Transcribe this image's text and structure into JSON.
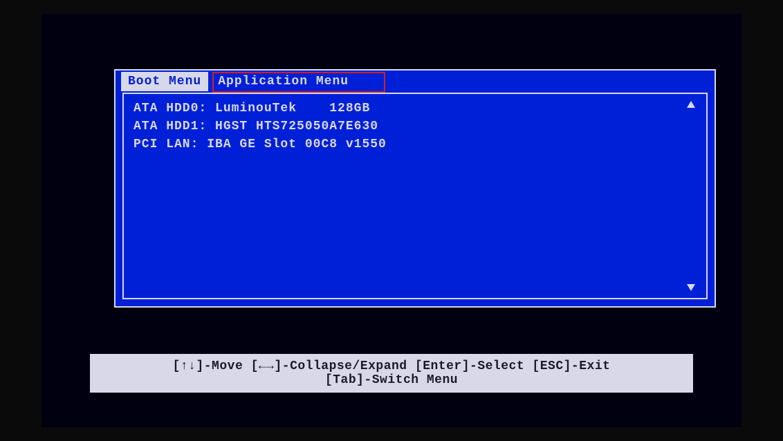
{
  "tabs": [
    {
      "label": "Boot Menu",
      "active": true
    },
    {
      "label": "Application Menu",
      "active": false
    }
  ],
  "boot_items": [
    {
      "label": "ATA HDD0: LuminouTek    128GB"
    },
    {
      "label": "ATA HDD1: HGST HTS725050A7E630"
    },
    {
      "label": "PCI LAN: IBA GE Slot 00C8 v1550"
    }
  ],
  "help": {
    "line1": "[↑↓]-Move [←→]-Collapse/Expand [Enter]-Select [ESC]-Exit",
    "line2": "[Tab]-Switch Menu"
  }
}
